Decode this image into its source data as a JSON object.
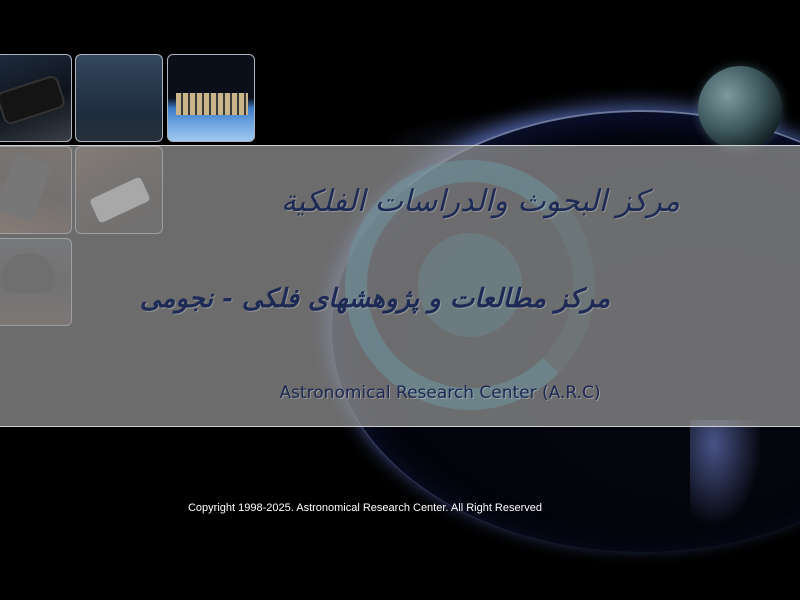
{
  "branding": {
    "title_arabic": "مركز البحوث والدراسات الفلكية",
    "title_persian": "مرکز مطالعات و پژوهشهای فلکی - نجومی",
    "title_english": "Astronomical Research Center (A.R.C)"
  },
  "gallery": {
    "thumbnails": [
      {
        "name": "telescope-night-sky"
      },
      {
        "name": "night-sky"
      },
      {
        "name": "space-station-earth"
      },
      {
        "name": "telescope-mount"
      },
      {
        "name": "telescope-observatory"
      },
      {
        "name": "observatory-dome"
      }
    ]
  },
  "footer": {
    "copyright": "Copyright 1998-2025. Astronomical Research Center. All Right Reserved"
  },
  "colors": {
    "background": "#000000",
    "banner": "#969696",
    "title_text": "#1c2a55",
    "footer_text": "#ffffff"
  }
}
